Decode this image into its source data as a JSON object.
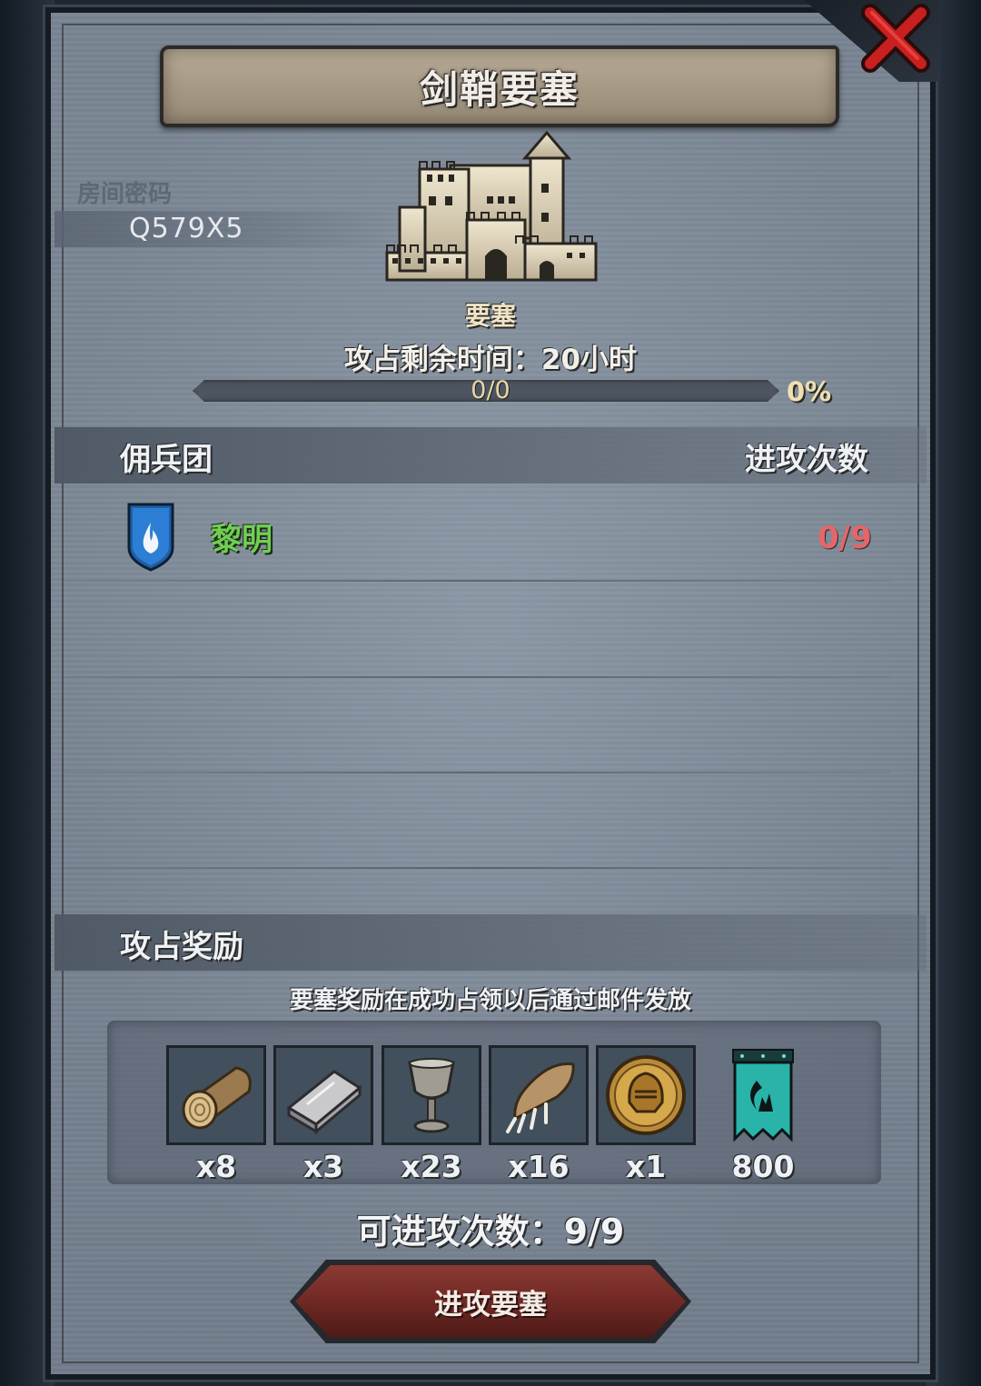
{
  "title": "剑鞘要塞",
  "room": {
    "label": "房间密码",
    "code": "Q579X5"
  },
  "fortress": {
    "type_label": "要塞",
    "time_text": "攻占剩余时间：20小时",
    "progress_text": "0/0",
    "progress_percent_text": "0%",
    "progress_fraction": 0
  },
  "guild_section": {
    "header_left": "佣兵团",
    "header_right": "进攻次数",
    "rows": [
      {
        "name": "黎明",
        "attacks": "0/9",
        "emblem_icon": "fire-shield-icon"
      }
    ]
  },
  "rewards": {
    "header": "攻占奖励",
    "note": "要塞奖励在成功占领以后通过邮件发放",
    "items": [
      {
        "icon": "wood-log-icon",
        "count": "x8"
      },
      {
        "icon": "iron-ingot-icon",
        "count": "x3"
      },
      {
        "icon": "goblet-icon",
        "count": "x23"
      },
      {
        "icon": "beast-claw-icon",
        "count": "x16"
      },
      {
        "icon": "knight-helmet-coin-icon",
        "count": "x1"
      },
      {
        "icon": "guild-banner-icon",
        "count": "800"
      }
    ]
  },
  "attack_count_text": "可进攻次数：9/9",
  "attack_button_label": "进攻要塞",
  "colors": {
    "guild_name": "#6fcf52",
    "attacks_red": "#e4666a",
    "button_red": "#6d2723",
    "progress_fill": "#b79b52"
  }
}
